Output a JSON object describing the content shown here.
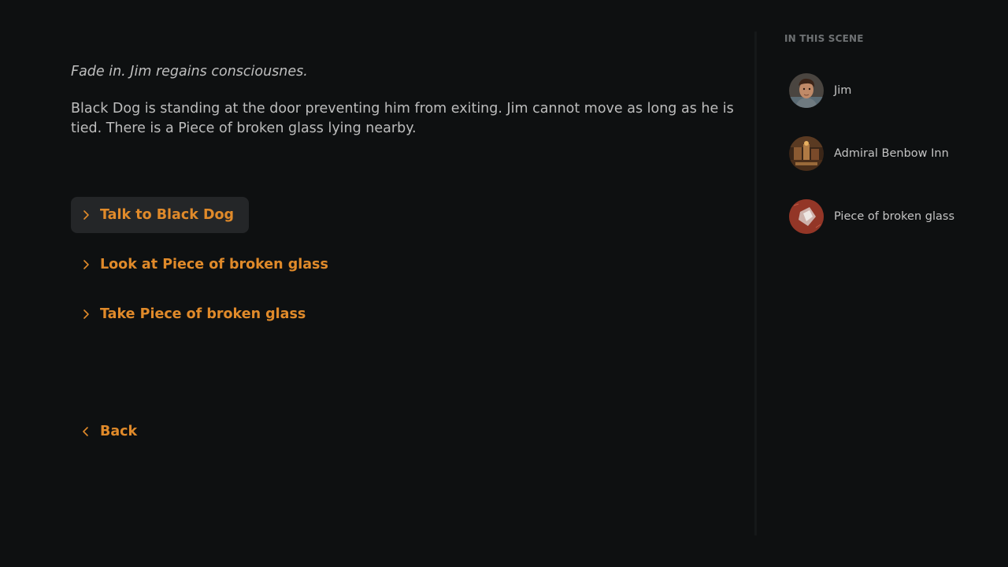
{
  "story": {
    "intro": "Fade in. Jim regains consciousnes.",
    "description": "Black Dog is standing at the door preventing him from exiting. Jim cannot move as long as he is tied. There is a Piece of broken glass lying nearby."
  },
  "choices": [
    {
      "label": "Talk to Black Dog",
      "active": true
    },
    {
      "label": "Look at Piece of broken glass",
      "active": false
    },
    {
      "label": "Take Piece of broken glass",
      "active": false
    }
  ],
  "back": {
    "label": "Back"
  },
  "sidebar": {
    "heading": "IN THIS SCENE",
    "entities": [
      {
        "label": "Jim",
        "icon": "jim-portrait"
      },
      {
        "label": "Admiral Benbow Inn",
        "icon": "inn-picture"
      },
      {
        "label": "Piece of broken glass",
        "icon": "glass-picture"
      }
    ]
  },
  "colors": {
    "background": "#0e1011",
    "accent": "#e08a2a",
    "text": "#bdbdbd",
    "active_choice_bg": "#242628"
  }
}
